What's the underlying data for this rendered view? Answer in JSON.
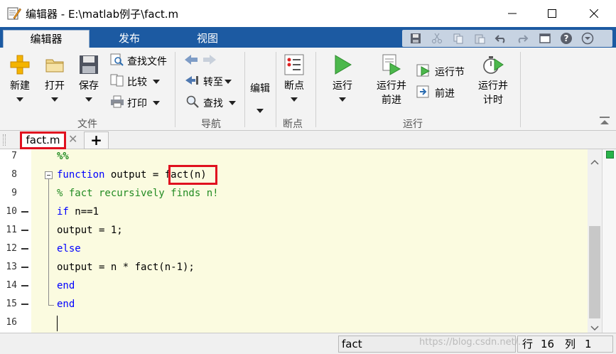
{
  "window": {
    "title": "编辑器 - E:\\matlab例子\\fact.m"
  },
  "ribbon_tabs": [
    {
      "label": "编辑器",
      "active": true
    },
    {
      "label": "发布",
      "active": false
    },
    {
      "label": "视图",
      "active": false
    }
  ],
  "quick_access": [
    "save-icon",
    "cut-icon",
    "copy-icon",
    "paste-icon",
    "undo-icon",
    "redo-icon",
    "window-icon",
    "help-icon",
    "dropdown-icon"
  ],
  "ribbon": {
    "file_group": {
      "label": "文件",
      "new": "新建",
      "open": "打开",
      "save": "保存",
      "find_files": "查找文件",
      "compare": "比较",
      "print": "打印"
    },
    "nav_group": {
      "label": "导航",
      "goto": "转至",
      "find": "查找"
    },
    "edit_group": {
      "edit": "编辑"
    },
    "breakpoint_group": {
      "label": "断点",
      "breakpoints": "断点"
    },
    "run_group": {
      "label": "运行",
      "run": "运行",
      "run_advance_line1": "运行并",
      "run_advance_line2": "前进",
      "run_section": "运行节",
      "advance": "前进",
      "run_time_line1": "运行并",
      "run_time_line2": "计时"
    }
  },
  "document": {
    "tab_label": "fact.m",
    "add_tab": "+",
    "lines": [
      {
        "n": "7",
        "breakpoint_dash": false
      },
      {
        "n": "8",
        "breakpoint_dash": false
      },
      {
        "n": "9",
        "breakpoint_dash": false
      },
      {
        "n": "10",
        "breakpoint_dash": true
      },
      {
        "n": "11",
        "breakpoint_dash": true
      },
      {
        "n": "12",
        "breakpoint_dash": true
      },
      {
        "n": "13",
        "breakpoint_dash": true
      },
      {
        "n": "14",
        "breakpoint_dash": true
      },
      {
        "n": "15",
        "breakpoint_dash": true
      },
      {
        "n": "16",
        "breakpoint_dash": false
      }
    ],
    "code": {
      "l7": "%%",
      "l8_kw": "function",
      "l8_rest": " output = ",
      "l8_call": "fact(n)",
      "l9": "% fact recursively finds n!",
      "l10_kw": "if",
      "l10_rest": " n==1",
      "l11": "output = 1;",
      "l12_kw": "else",
      "l13": "output = n * fact(n-1);",
      "l14_kw": "end",
      "l15_kw": "end"
    }
  },
  "status": {
    "function_name": "fact",
    "row_label": "行",
    "row": "16",
    "col_label": "列",
    "col": "1",
    "watermark": "https://blog.csdn.net/..."
  },
  "colors": {
    "accent_blue": "#1c5aa2",
    "highlight_red": "#e0101f",
    "editor_bg": "#fbfbe0",
    "keyword": "#0000ff",
    "comment": "#228b22"
  }
}
